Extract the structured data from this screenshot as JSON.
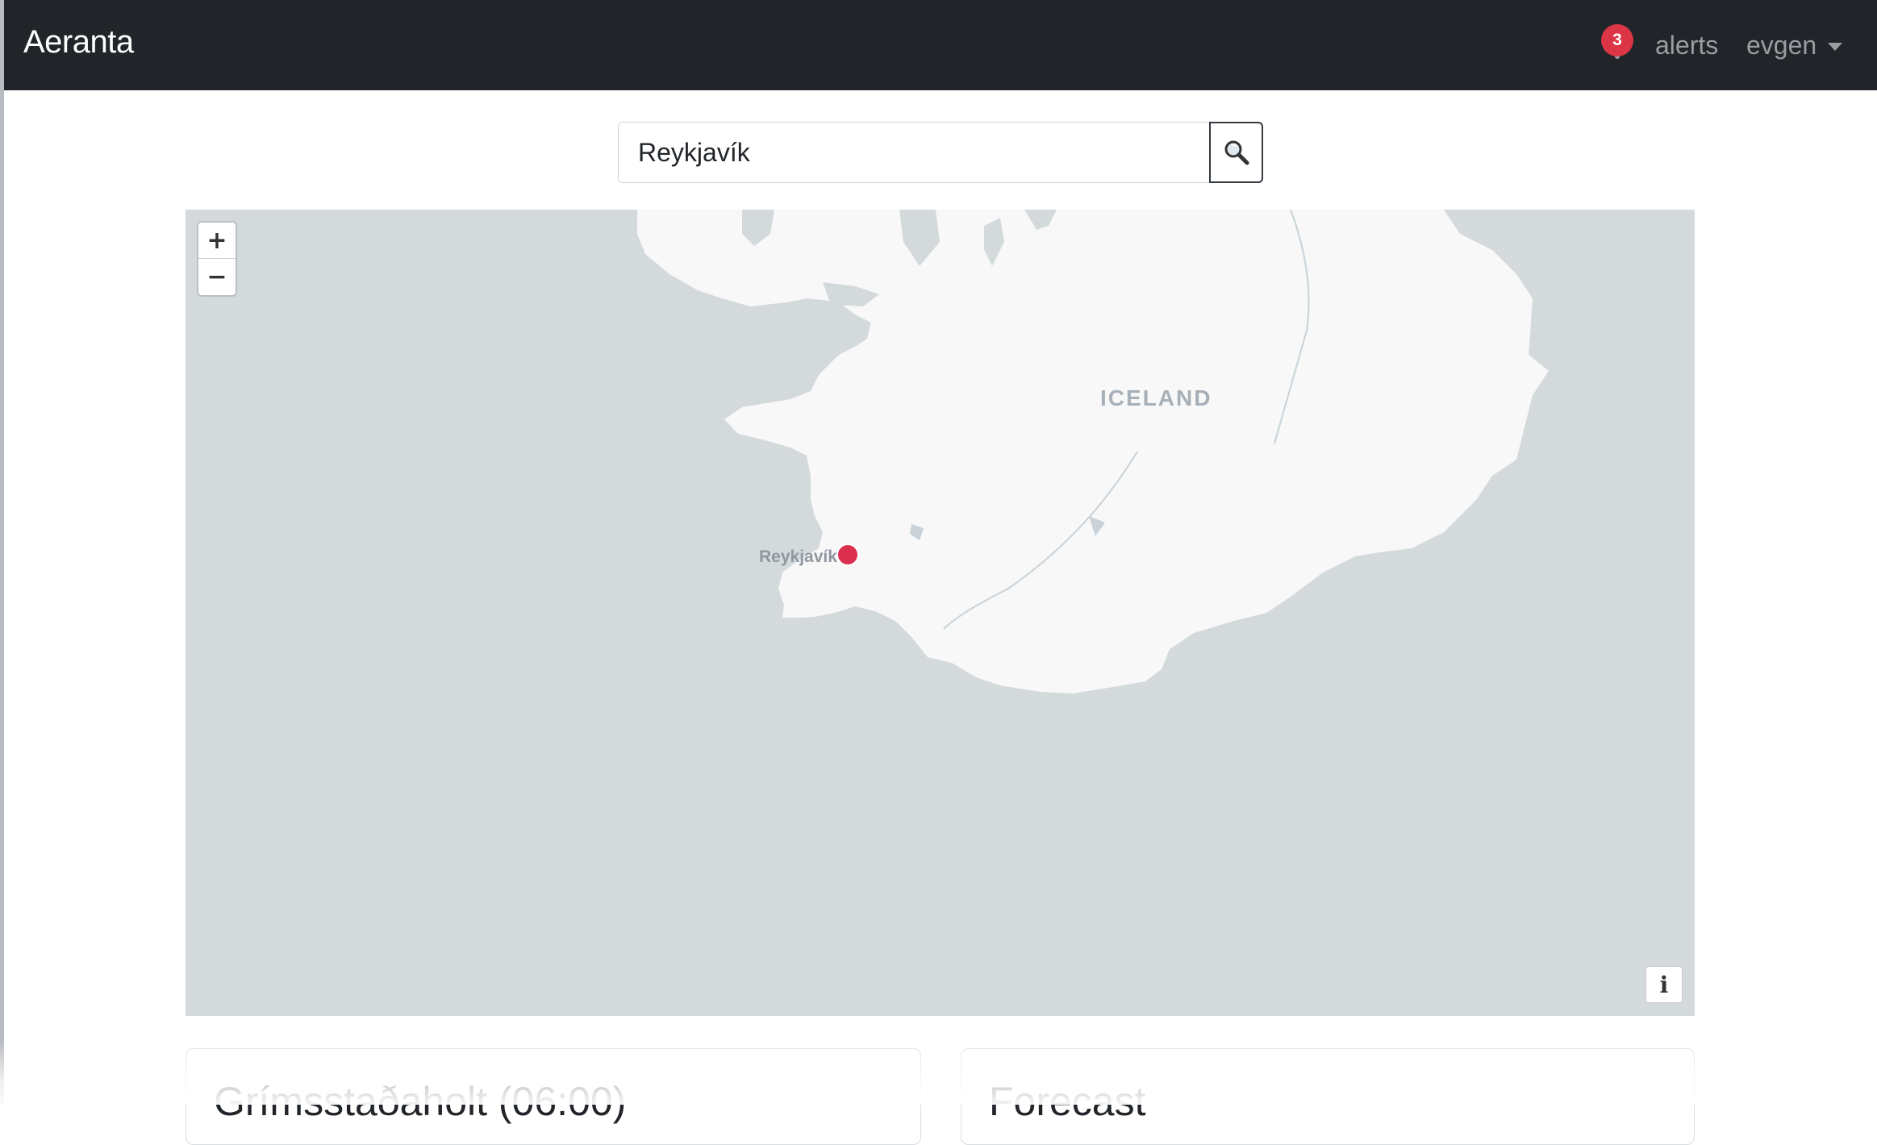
{
  "navbar": {
    "brand": "Aeranta",
    "notification_count": "3",
    "alerts_label": "alerts",
    "user_label": "evgen"
  },
  "search": {
    "value": "Reykjavík",
    "button_icon": "search-icon"
  },
  "map": {
    "zoom_in_label": "+",
    "zoom_out_label": "−",
    "country_label": "ICELAND",
    "marker_label": "Reykjavík",
    "info_label": "i",
    "marker_color": "#dc2e4e",
    "water_color": "#d4dadc",
    "land_color": "#f8f8f8"
  },
  "cards": {
    "left_title": "Grímsstaðaholt (06:00)",
    "right_title": "Forecast"
  },
  "colors": {
    "navbar": "#212529",
    "badge": "#dc3545"
  }
}
